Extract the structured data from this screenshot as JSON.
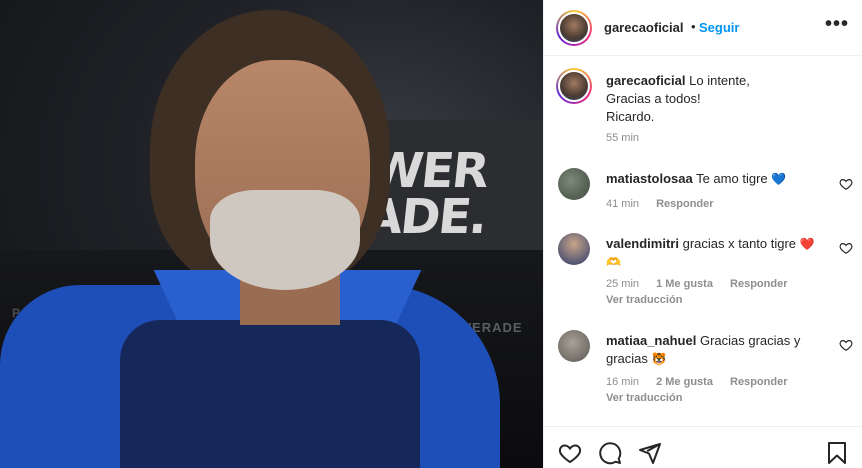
{
  "post": {
    "author": "garecaoficial",
    "follow_label": "Seguir",
    "dot": "•",
    "more_label": "•••",
    "caption_lines": [
      "Lo intente,",
      "Gracias a todos!",
      "Ricardo."
    ],
    "caption_time": "55 min"
  },
  "photo": {
    "banner_text_1": "WER",
    "banner_text_2": "ADE.",
    "bench_logo": "POWERADE",
    "bench_logo_left": "P"
  },
  "comments": [
    {
      "username": "matiastolosaa",
      "text": "Te amo tigre",
      "emoji": "💙",
      "time": "41 min",
      "likes": "",
      "reply": "Responder",
      "translate": ""
    },
    {
      "username": "valendimitri",
      "text": "gracias x tanto tigre",
      "emoji": "❤️",
      "emoji2": "🫶",
      "time": "25 min",
      "likes": "1 Me gusta",
      "reply": "Responder",
      "translate": "Ver traducción"
    },
    {
      "username": "matiaa_nahuel",
      "text": "Gracias gracias y gracias",
      "emoji": "🐯",
      "time": "16 min",
      "likes": "2 Me gusta",
      "reply": "Responder",
      "translate": "Ver traducción"
    }
  ],
  "icons": {
    "like": "heart-icon",
    "comment": "comment-icon",
    "share": "share-icon",
    "save": "bookmark-icon"
  },
  "colors": {
    "link_blue": "#0095f6",
    "meta_gray": "#8e8e8e",
    "text": "#262626",
    "heart_red": "#ed4956",
    "heart_blue": "#1f5fc7"
  }
}
